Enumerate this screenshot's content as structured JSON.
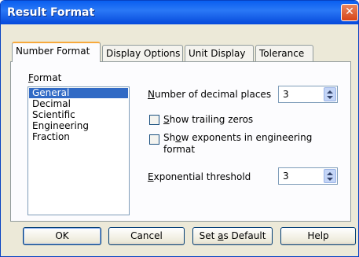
{
  "dialog": {
    "title": "Result Format",
    "close_glyph": "✕"
  },
  "tabs": [
    {
      "label": "Number Format",
      "active": true
    },
    {
      "label": "Display Options",
      "active": false
    },
    {
      "label": "Unit Display",
      "active": false
    },
    {
      "label": "Tolerance",
      "active": false
    }
  ],
  "format": {
    "label_first": "F",
    "label_rest": "ormat",
    "items": [
      "General",
      "Decimal",
      "Scientific",
      "Engineering",
      "Fraction"
    ],
    "selected": "General"
  },
  "decimal_places": {
    "label_first": "N",
    "label_rest": "umber of decimal places",
    "value": "3"
  },
  "trailing_zeros": {
    "label_first": "S",
    "label_rest": "how trailing zeros",
    "checked": false
  },
  "exponents": {
    "label_pre": "Sh",
    "label_u": "o",
    "label_post": "w exponents in engineering",
    "label_line2": "format",
    "checked": false
  },
  "exp_threshold": {
    "label_first": "E",
    "label_rest": "xponential threshold",
    "value": "3"
  },
  "buttons": {
    "ok": "OK",
    "cancel": "Cancel",
    "set_default_pre": "Set ",
    "set_default_u": "a",
    "set_default_post": "s Default",
    "help": "Help"
  }
}
